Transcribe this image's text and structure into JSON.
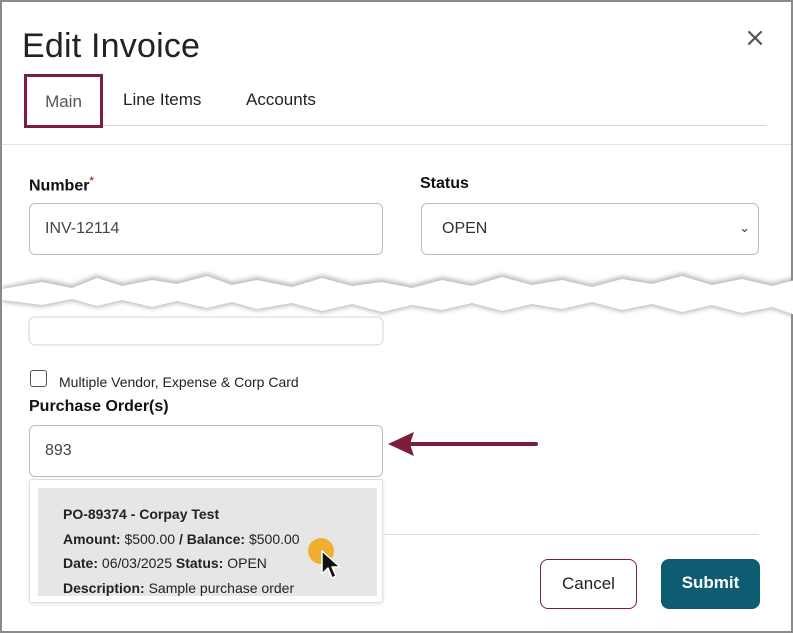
{
  "dialog": {
    "title": "Edit Invoice",
    "close_glyph": "×"
  },
  "tabs": [
    {
      "label": "Main"
    },
    {
      "label": "Line Items"
    },
    {
      "label": "Accounts"
    }
  ],
  "form": {
    "number": {
      "label": "Number",
      "required_mark": "*",
      "value": "INV-12114"
    },
    "status": {
      "label": "Status",
      "value": "OPEN"
    },
    "multiple_vendor": {
      "label": "Multiple Vendor, Expense & Corp Card",
      "checked": false
    },
    "purchase_orders": {
      "label": "Purchase Order(s)",
      "value": "893"
    }
  },
  "po_dropdown": {
    "option": {
      "title": "PO-89374 - Corpay Test",
      "amount_label": "Amount:",
      "amount": "$500.00",
      "balance_label": "/ Balance:",
      "balance": "$500.00",
      "date_label": "Date:",
      "date": "06/03/2025",
      "status_label": "Status:",
      "status": "OPEN",
      "description_label": "Description:",
      "description": "Sample purchase order"
    }
  },
  "buttons": {
    "cancel": "Cancel",
    "submit": "Submit"
  },
  "colors": {
    "accent_maroon": "#7b1e3a",
    "submit_teal": "#0e5c72",
    "cursor_highlight": "#f2a81d"
  }
}
